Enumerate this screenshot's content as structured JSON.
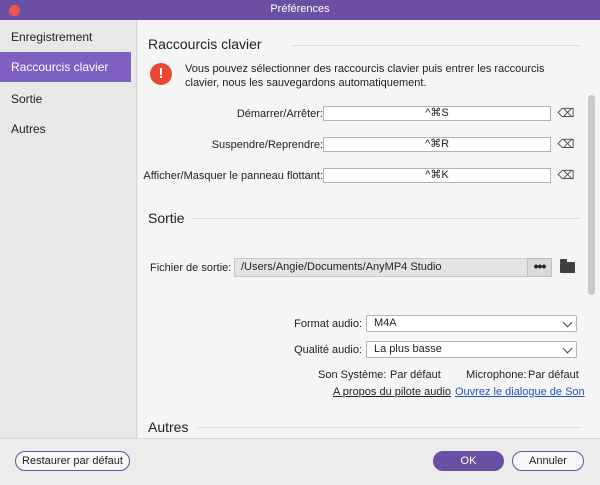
{
  "window": {
    "title": "Préférences"
  },
  "sidebar": {
    "items": [
      {
        "label": "Enregistrement"
      },
      {
        "label": "Raccourcis clavier",
        "active": true
      },
      {
        "label": "Sortie"
      },
      {
        "label": "Autres"
      }
    ]
  },
  "shortcuts": {
    "heading": "Raccourcis clavier",
    "warning": "Vous pouvez sélectionner des raccourcis clavier puis entrer les raccourcis clavier, nous les sauvegardons automatiquement.",
    "warning_icon": "!",
    "rows": [
      {
        "label": "Démarrer/Arrêter:",
        "value": "^⌘S"
      },
      {
        "label": "Suspendre/Reprendre:",
        "value": "^⌘R"
      },
      {
        "label": "Afficher/Masquer le panneau flottant:",
        "value": "^⌘K"
      }
    ],
    "clear_glyph": "⌫"
  },
  "output": {
    "heading": "Sortie",
    "file_label": "Fichier de sortie:",
    "path": "/Users/Angie/Documents/AnyMP4 Studio",
    "browse_glyph": "•••",
    "audio_format_label": "Format audio:",
    "audio_format_value": "M4A",
    "audio_quality_label": "Qualité audio:",
    "audio_quality_value": "La plus basse",
    "system_sound_label": "Son Système:",
    "system_sound_value": "Par défaut",
    "microphone_label": "Microphone:",
    "microphone_value": "Par défaut",
    "audio_driver_link": "A propos du pilote audio",
    "sound_dialog_link": "Ouvrez le dialogue de Son"
  },
  "others": {
    "heading": "Autres"
  },
  "footer": {
    "restore_label": "Restaurer par défaut",
    "ok_label": "OK",
    "cancel_label": "Annuler"
  },
  "colors": {
    "accent": "#6b4fa3",
    "sidebar_active": "#7d60c2",
    "warning": "#e8482f",
    "link": "#2452c8"
  }
}
